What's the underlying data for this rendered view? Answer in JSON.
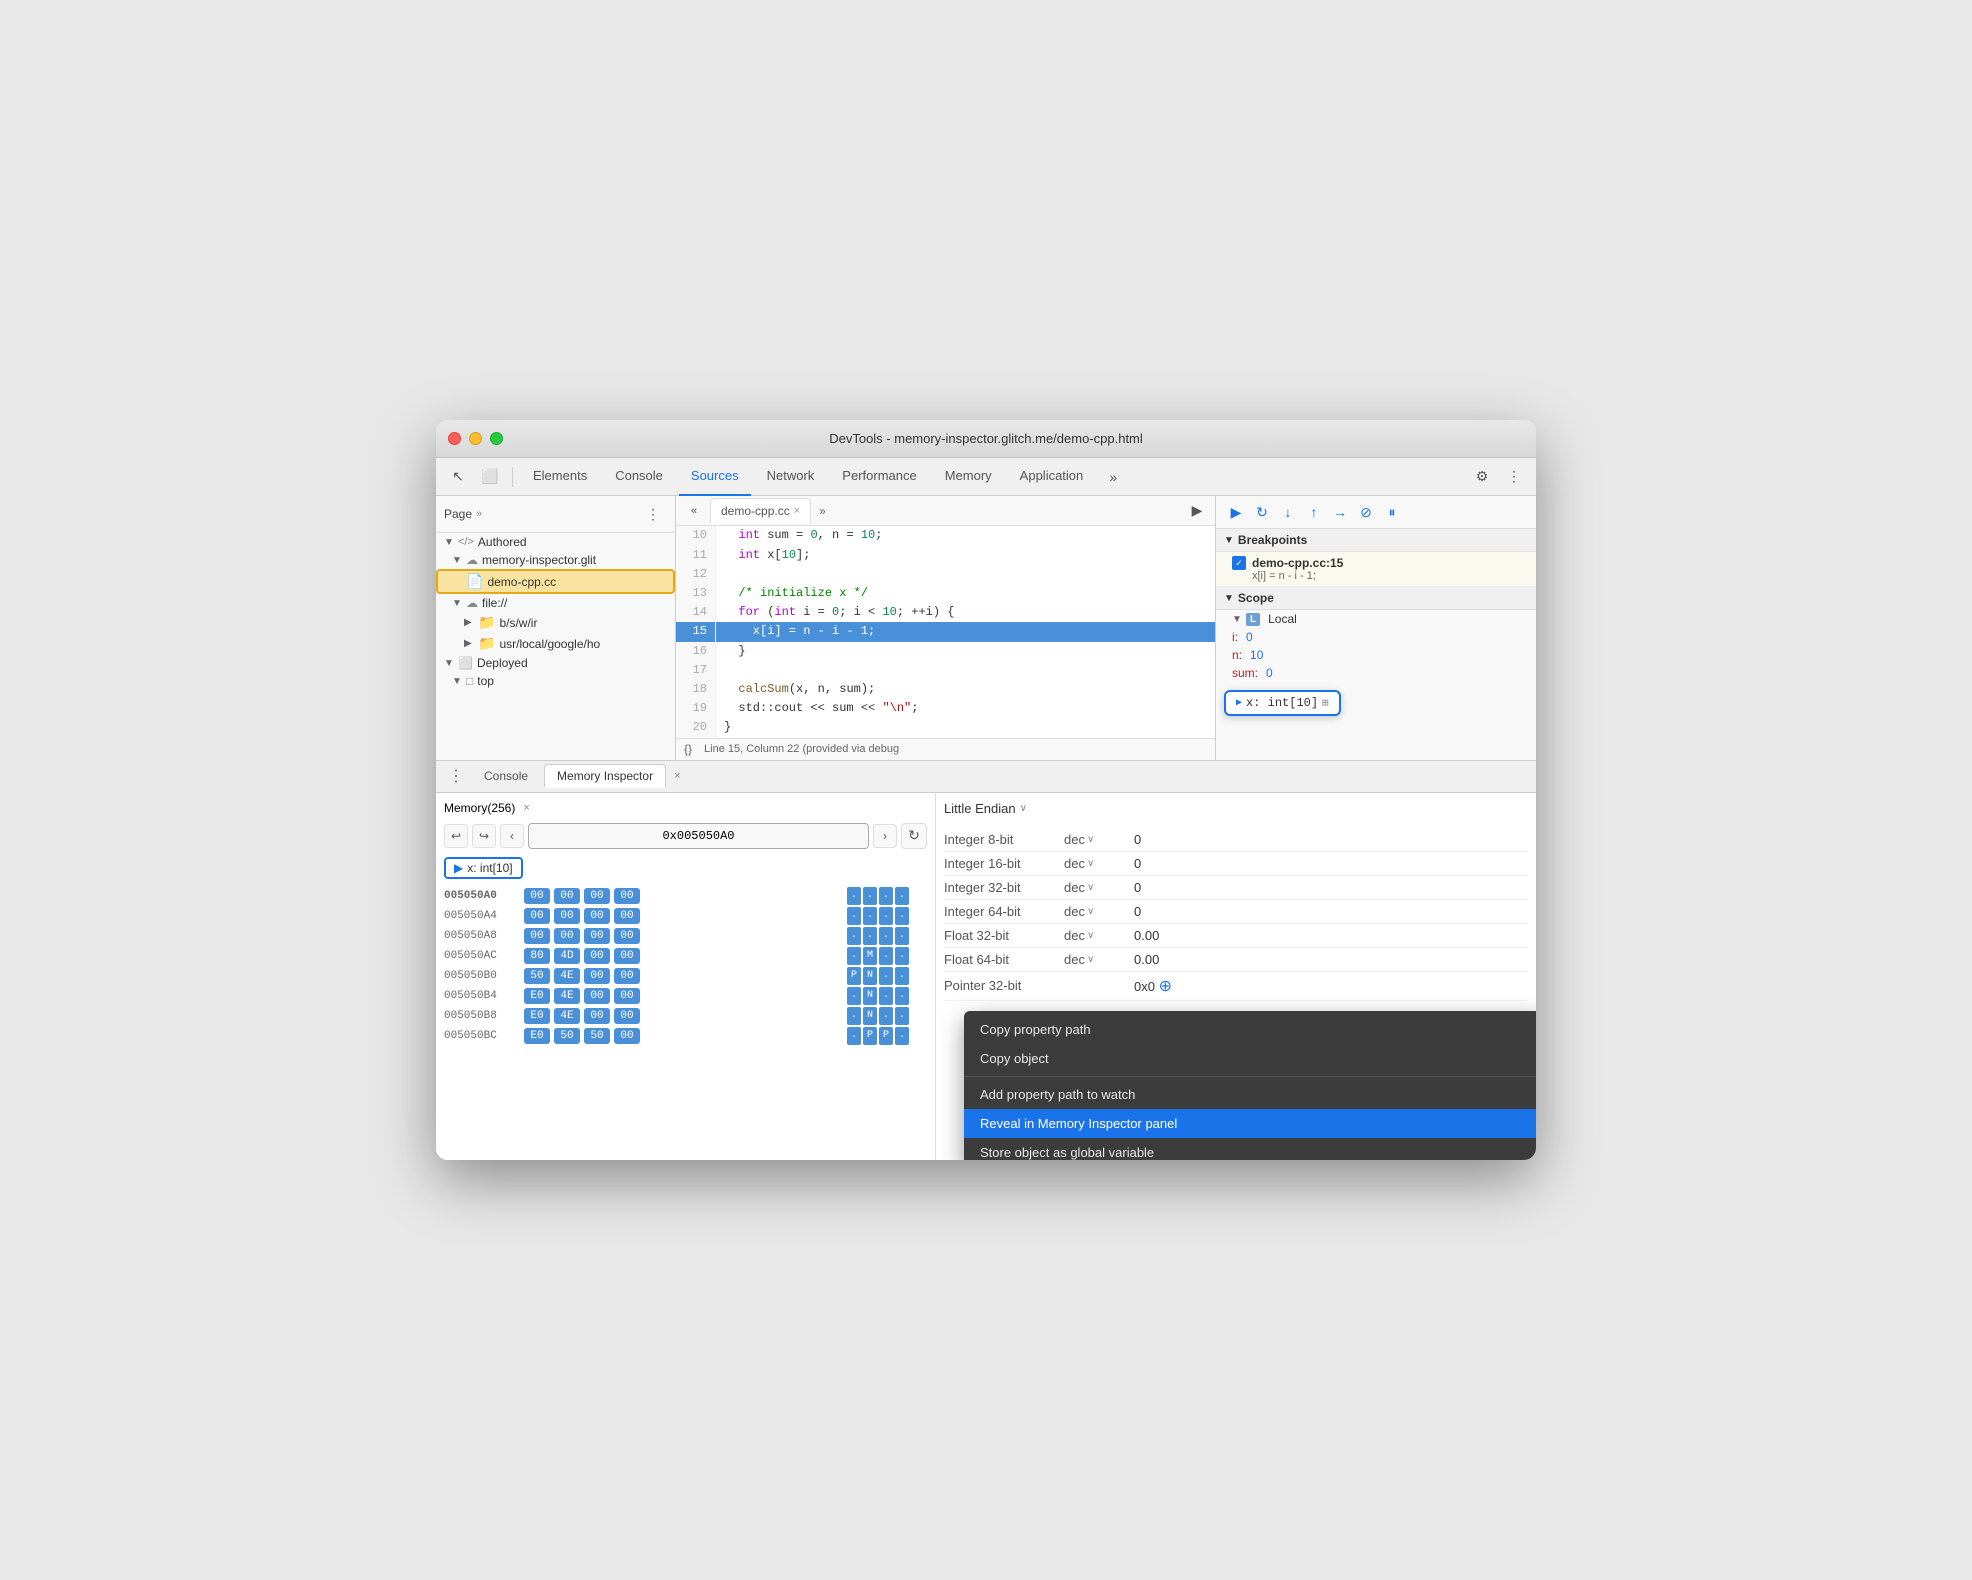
{
  "window": {
    "title": "DevTools - memory-inspector.glitch.me/demo-cpp.html"
  },
  "toolbar": {
    "tabs": [
      "Elements",
      "Console",
      "Sources",
      "Network",
      "Performance",
      "Memory",
      "Application"
    ],
    "active_tab": "Sources"
  },
  "file_panel": {
    "header": "Page",
    "tree": [
      {
        "label": "Authored",
        "type": "section",
        "indent": 0
      },
      {
        "label": "memory-inspector.glit",
        "type": "cloud",
        "indent": 1
      },
      {
        "label": "demo-cpp.cc",
        "type": "file",
        "indent": 2,
        "selected": true
      },
      {
        "label": "file://",
        "type": "cloud",
        "indent": 1
      },
      {
        "label": "b/s/w/ir",
        "type": "folder",
        "indent": 2
      },
      {
        "label": "usr/local/google/ho",
        "type": "folder",
        "indent": 2
      },
      {
        "label": "Deployed",
        "type": "section",
        "indent": 0
      },
      {
        "label": "top",
        "type": "page",
        "indent": 1
      }
    ]
  },
  "source": {
    "filename": "demo-cpp.cc",
    "lines": [
      {
        "num": 10,
        "code": "  int sum = 0, n = 10;"
      },
      {
        "num": 11,
        "code": "  int x[10];"
      },
      {
        "num": 12,
        "code": ""
      },
      {
        "num": 13,
        "code": "  /* initialize x */"
      },
      {
        "num": 14,
        "code": "  for (int i = 0; i < 10; ++i) {"
      },
      {
        "num": 15,
        "code": "    x[i] = n - i - 1;",
        "active": true
      },
      {
        "num": 16,
        "code": "  }"
      },
      {
        "num": 17,
        "code": ""
      },
      {
        "num": 18,
        "code": "  calcSum(x, n, sum);"
      },
      {
        "num": 19,
        "code": "  std::cout << sum << \"\\n\";"
      },
      {
        "num": 20,
        "code": "}"
      }
    ],
    "statusbar": "Line 15, Column 22 (provided via debug"
  },
  "debug": {
    "breakpoints_label": "Breakpoints",
    "breakpoint": {
      "location": "demo-cpp.cc:15",
      "code": "x[i] = n - i - 1;"
    },
    "scope_label": "Scope",
    "local_label": "Local",
    "variables": [
      {
        "name": "i:",
        "value": "0"
      },
      {
        "name": "n:",
        "value": "10"
      },
      {
        "name": "sum:",
        "value": "0"
      }
    ],
    "var_popup": {
      "arrow": "▶",
      "text": "x: int[10]",
      "icon": "⊞"
    }
  },
  "bottom": {
    "tabs": [
      "Console",
      "Memory Inspector"
    ],
    "active_tab": "Memory Inspector",
    "memory_tab_label": "Memory(256)"
  },
  "memory": {
    "address": "0x005050A0",
    "tag_label": "x: int[10]",
    "rows": [
      {
        "addr": "005050A0",
        "bytes": [
          "00",
          "00",
          "00",
          "00"
        ],
        "ascii": [
          ".",
          ".",
          ".",
          ".",
          ".",
          ".",
          ".",
          ".",
          "."
        ],
        "bold": true
      },
      {
        "addr": "005050A4",
        "bytes": [
          "00",
          "00",
          "00",
          "00"
        ],
        "ascii": [
          ".",
          ".",
          ".",
          ".",
          ".",
          ".",
          ".",
          ".",
          ".",
          "."
        ]
      },
      {
        "addr": "005050A8",
        "bytes": [
          "00",
          "00",
          "00",
          "00"
        ],
        "ascii": [
          ".",
          ".",
          ".",
          ".",
          ".",
          ".",
          ".",
          ".",
          "."
        ]
      },
      {
        "addr": "005050AC",
        "bytes": [
          "80",
          "4D",
          "00",
          "00"
        ],
        "ascii": [
          ".",
          "M",
          ".",
          ".",
          ".",
          ".",
          ".",
          ".",
          "."
        ]
      },
      {
        "addr": "005050B0",
        "bytes": [
          "50",
          "4E",
          "00",
          "00"
        ],
        "ascii": [
          "P",
          "N",
          ".",
          ".",
          ".",
          ".",
          ".",
          ".",
          ".",
          "."
        ]
      },
      {
        "addr": "005050B4",
        "bytes": [
          "E0",
          "4E",
          "00",
          "00"
        ],
        "ascii": [
          ".",
          "N",
          ".",
          ".",
          ".",
          ".",
          ".",
          ".",
          ".",
          "."
        ]
      },
      {
        "addr": "005050B8",
        "bytes": [
          "E0",
          "4E",
          "00",
          "00"
        ],
        "ascii": [
          ".",
          "N",
          ".",
          ".",
          ".",
          ".",
          ".",
          ".",
          ".",
          "."
        ]
      },
      {
        "addr": "005050BC",
        "bytes": [
          "E0",
          "50",
          "50",
          "00"
        ],
        "ascii": [
          ".",
          "P",
          "P",
          ".",
          ".",
          ".",
          ".",
          ".",
          ".",
          ".",
          "."
        ]
      }
    ],
    "endian": "Little Endian",
    "values": [
      {
        "label": "Integer 8-bit",
        "format": "dec",
        "value": "0"
      },
      {
        "label": "Integer 16-bit",
        "format": "dec",
        "value": "0"
      },
      {
        "label": "Integer 32-bit",
        "format": "dec",
        "value": "0"
      },
      {
        "label": "Integer 64-bit",
        "format": "dec",
        "value": "0"
      },
      {
        "label": "Float 32-bit",
        "format": "dec",
        "value": "0.00"
      },
      {
        "label": "Float 64-bit",
        "format": "dec",
        "value": "0.00"
      },
      {
        "label": "Pointer 32-bit",
        "format": "",
        "value": "0x0"
      }
    ]
  },
  "context_menu": {
    "items": [
      {
        "label": "Copy property path",
        "type": "normal"
      },
      {
        "label": "Copy object",
        "type": "normal"
      },
      {
        "label": "divider"
      },
      {
        "label": "Add property path to watch",
        "type": "normal"
      },
      {
        "label": "Reveal in Memory Inspector panel",
        "type": "highlighted"
      },
      {
        "label": "Store object as global variable",
        "type": "normal"
      }
    ]
  },
  "icons": {
    "arrow_right": "▶",
    "arrow_down": "▼",
    "back": "↩",
    "forward": "↪",
    "left": "‹",
    "right": "›",
    "refresh": "↻",
    "close": "×",
    "check": "✓",
    "more": "⋮",
    "more_horiz": "⋯",
    "settings": "⚙",
    "cursor": "↖",
    "copy_icon": "⧉",
    "step_over": "↷",
    "step_into": "↓",
    "step_out": "↑",
    "deactivate": "⊘",
    "pause": "⏸",
    "resume": "▶"
  }
}
